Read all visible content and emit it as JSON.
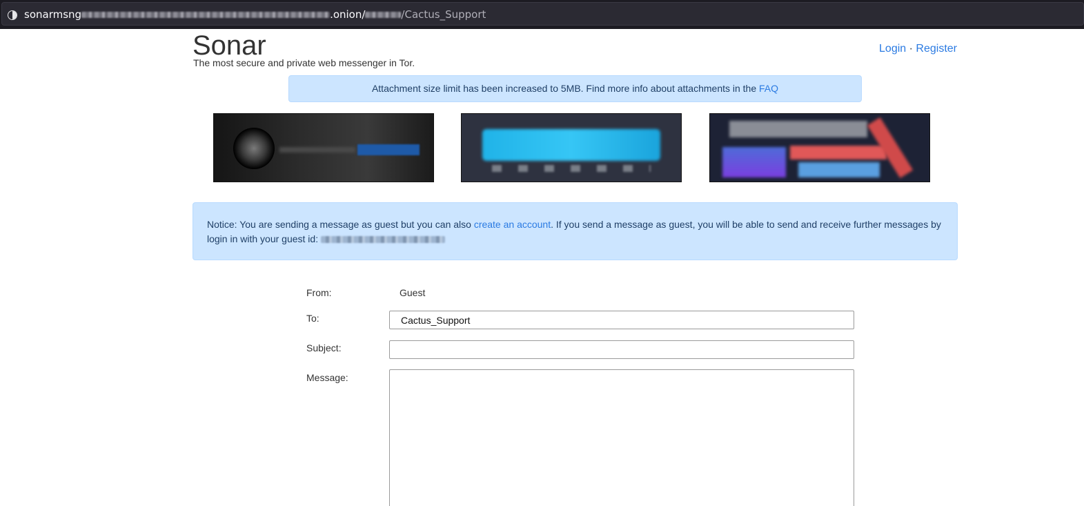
{
  "browser": {
    "url_prefix": "sonarmsng",
    "url_onion": ".onion/",
    "url_path": "/Cactus_Support"
  },
  "header": {
    "logo": "Sonar",
    "tagline": "The most secure and private web messenger in Tor.",
    "login": "Login",
    "separator": "·",
    "register": "Register"
  },
  "alert": {
    "text": "Attachment size limit has been increased to 5MB. Find more info about attachments in the ",
    "link": "FAQ"
  },
  "notice": {
    "text_before": "Notice: You are sending a message as guest but you can also ",
    "link": "create an account",
    "text_after": ". If you send a message as guest, you will be able to send and receive further messages by login in with your guest id: "
  },
  "form": {
    "from_label": "From:",
    "from_value": "Guest",
    "to_label": "To:",
    "to_value": "Cactus_Support",
    "subject_label": "Subject:",
    "subject_value": "",
    "message_label": "Message:",
    "message_value": ""
  }
}
